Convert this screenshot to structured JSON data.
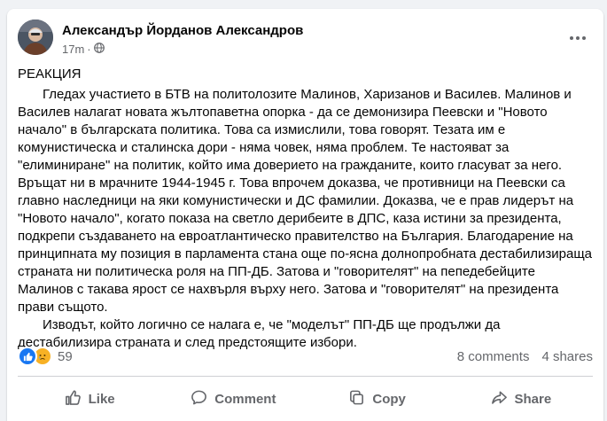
{
  "post": {
    "author": "Александър Йорданов Александров",
    "time": "17m",
    "audience_icon": "globe-icon",
    "title": "РЕАКЦИЯ",
    "paragraph_1": "Гледах участието в БТВ на политолозите Малинов, Харизанов и Василев. Малинов и Василев налагат новата жълтопаветна опорка - да се демонизира Пеевски и \"Новото начало\" в българската политика. Това са измислили, това говорят. Тезата им е комунистическа и сталинска дори - няма човек, няма проблем. Те настояват за \"елиминиране\" на политик, който има доверието на гражданите, които гласуват за него. Връщат ни в мрачните 1944-1945 г. Това впрочем доказва, че противници на Пеевски са главно наследници на яки комунистически и ДС фамилии. Доказва, че е прав лидерът на \"Новото начало\", когато показа на светло дерибеите в ДПС, каза истини за президента, подкрепи създаването на евроатлантическо правителство на България. Благодарение на принципната му позиция в парламента стана още по-ясна долнопробната дестабилизираща страната ни политическа роля на ПП-ДБ. Затова и \"говорителят\" на пепедебейците Малинов с такава ярост се нахвърля върху него. Затова и \"говорителят\" на президента прави същото.",
    "paragraph_2": "Изводът, който логично се налага е, че \"моделът\" ПП-ДБ ще продължи да дестабилизира страната и след предстоящите избори."
  },
  "stats": {
    "reactions": [
      "like",
      "sad"
    ],
    "reaction_count": "59",
    "comments": "8 comments",
    "shares": "4 shares"
  },
  "actions": {
    "like": "Like",
    "comment": "Comment",
    "copy": "Copy",
    "share": "Share"
  },
  "colors": {
    "brand_blue": "#1877f2",
    "secondary_text": "#65676b",
    "sad_yellow": "#f7b125"
  }
}
